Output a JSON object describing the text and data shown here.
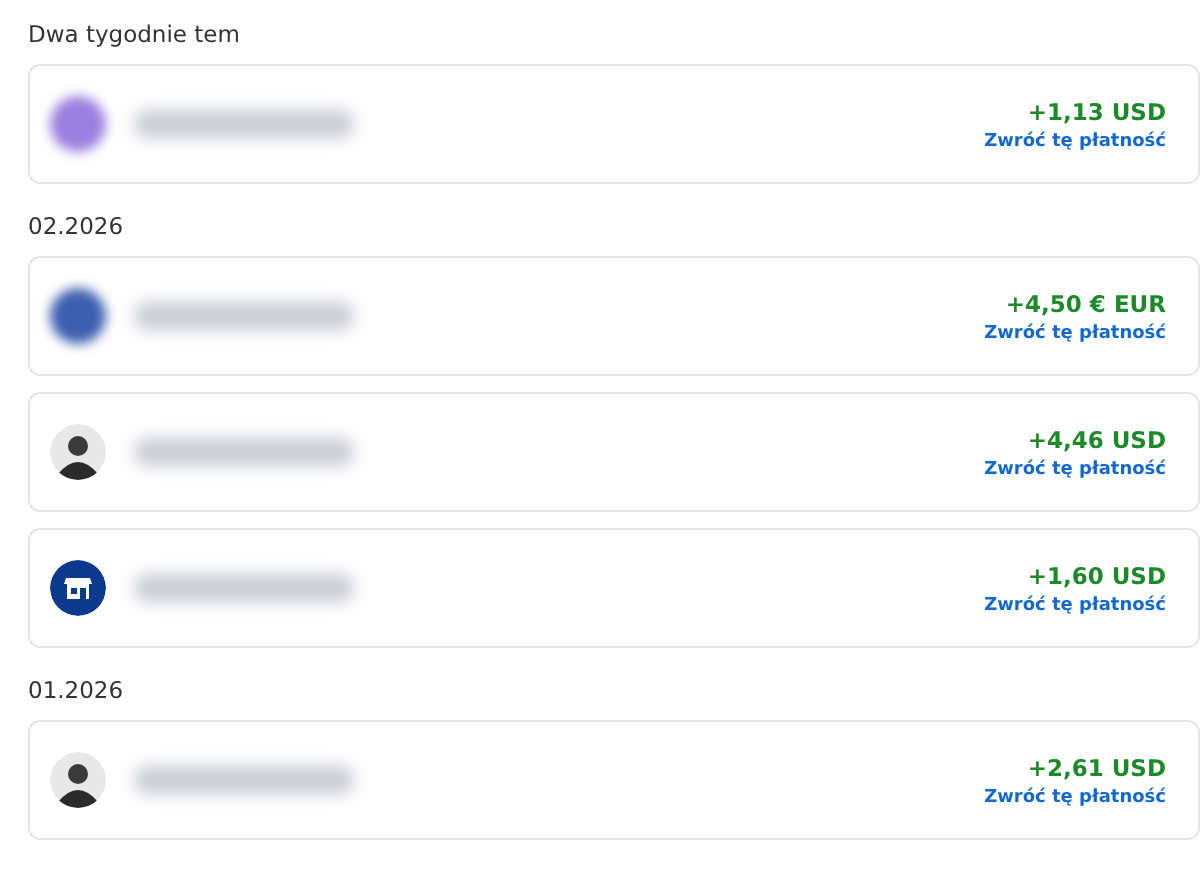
{
  "groups": [
    {
      "heading": "Dwa tygodnie tem",
      "transactions": [
        {
          "avatar": {
            "kind": "blurred",
            "color": "#9b7fe0"
          },
          "amount": "+1,13 USD",
          "action": "Zwróć tę płatność"
        }
      ]
    },
    {
      "heading": "02.2026",
      "transactions": [
        {
          "avatar": {
            "kind": "blurred",
            "color": "#3d5fb0"
          },
          "amount": "+4,50 € EUR",
          "action": "Zwróć tę płatność"
        },
        {
          "avatar": {
            "kind": "photo"
          },
          "amount": "+4,46 USD",
          "action": "Zwróć tę płatność"
        },
        {
          "avatar": {
            "kind": "store"
          },
          "amount": "+1,60 USD",
          "action": "Zwróć tę płatność"
        }
      ]
    },
    {
      "heading": "01.2026",
      "transactions": [
        {
          "avatar": {
            "kind": "photo"
          },
          "amount": "+2,61 USD",
          "action": "Zwróć tę płatność"
        }
      ]
    }
  ]
}
